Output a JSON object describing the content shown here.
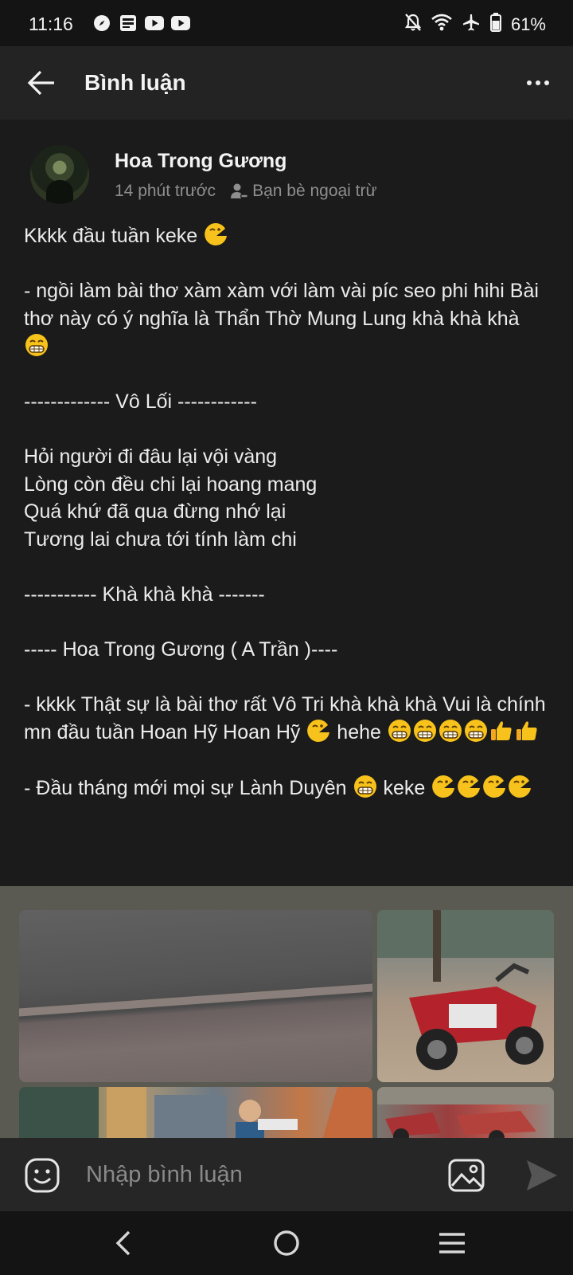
{
  "status_bar": {
    "time": "11:16",
    "battery_percent": "61%",
    "left_icons": [
      "compass-icon",
      "bao-moi-icon",
      "youtube-icon",
      "youtube-icon"
    ],
    "right_icons": [
      "notifications-off-icon",
      "wifi-icon",
      "airplane-icon",
      "battery-icon"
    ]
  },
  "header": {
    "title": "Bình luận",
    "back_icon": "arrow-left-icon",
    "menu_icon": "more-horizontal-icon"
  },
  "post": {
    "author": "Hoa Trong Gương",
    "time": "14 phút trước",
    "audience": "Bạn bè ngoại trừ",
    "lines": [
      {
        "text": "Kkkk đầu tuần  keke ",
        "emojis": [
          "wink"
        ]
      },
      {
        "text": "",
        "emojis": []
      },
      {
        "text": "- ngồi làm bài thơ xàm xàm với làm vài píc seo phi hihi Bài thơ này có ý nghĩa là Thẩn Thờ Mung Lung khà khà khà ",
        "emojis": [
          "grin"
        ]
      },
      {
        "text": "",
        "emojis": []
      },
      {
        "text": "------------- Vô Lối ------------",
        "emojis": []
      },
      {
        "text": "",
        "emojis": []
      },
      {
        "text": "Hỏi người đi đâu lại vội vàng",
        "emojis": []
      },
      {
        "text": "Lòng còn đều chi lại hoang mang",
        "emojis": []
      },
      {
        "text": "Quá khứ đã qua đừng nhớ lại",
        "emojis": []
      },
      {
        "text": "Tương lai chưa tới tính làm chi",
        "emojis": []
      },
      {
        "text": "",
        "emojis": []
      },
      {
        "text": "----------- Khà khà khà -------",
        "emojis": []
      },
      {
        "text": "",
        "emojis": []
      },
      {
        "text": "----- Hoa Trong Gương ( A Trần )----",
        "emojis": []
      },
      {
        "text": "",
        "emojis": []
      },
      {
        "text": "- kkkk Thật sự là bài thơ rất Vô Tri khà khà khà Vui là chính mn đầu tuần Hoan Hỹ Hoan Hỹ ",
        "emojis": [
          "wink"
        ],
        "tail": " hehe ",
        "tail_emojis": [
          "grin",
          "grin",
          "grin",
          "grin",
          "thumbsup",
          "thumbsup"
        ]
      },
      {
        "text": "",
        "emojis": []
      },
      {
        "text": "- Đầu tháng mới mọi sự Lành Duyên ",
        "emojis": [
          "grin"
        ],
        "tail": " keke ",
        "tail_emojis": [
          "wink",
          "wink",
          "wink",
          "wink"
        ]
      }
    ],
    "photos": [
      "photo-pavement",
      "photo-motorbike",
      "photo-street",
      "photo-motorbikes-row"
    ]
  },
  "comment_bar": {
    "placeholder": "Nhập bình luận",
    "emoji_icon": "emoji-icon",
    "image_icon": "image-icon",
    "send_icon": "send-icon"
  },
  "nav_bar": {
    "icons": [
      "nav-back-icon",
      "nav-home-icon",
      "nav-recent-icon"
    ]
  }
}
